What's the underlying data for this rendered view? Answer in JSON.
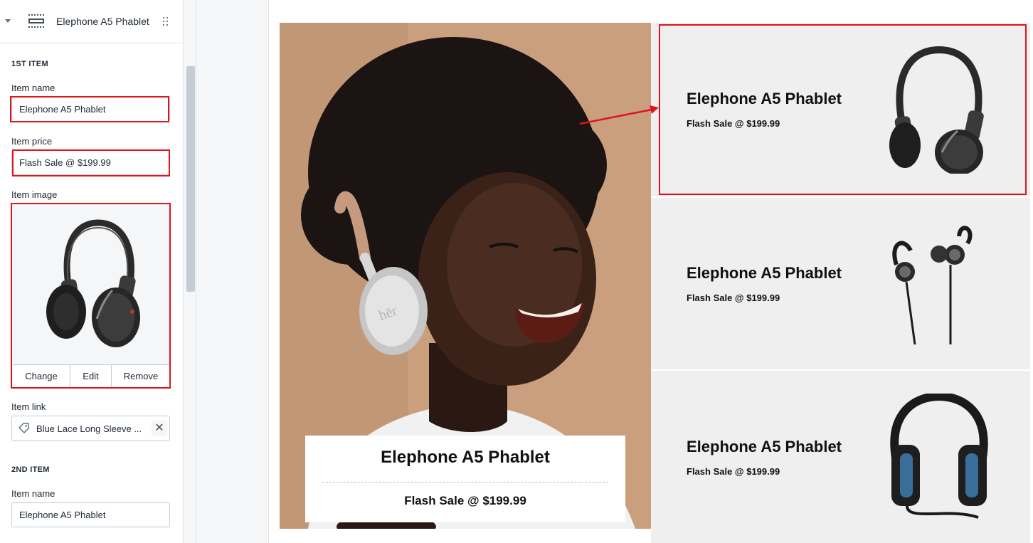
{
  "sidebar": {
    "header": {
      "title": "Elephone A5 Phablet",
      "icon": "section-icon",
      "drag_icon": "drag-handle-icon"
    },
    "first_item": {
      "heading": "1ST ITEM",
      "name_label": "Item name",
      "name_value": "Elephone A5 Phablet",
      "price_label": "Item price",
      "price_value": "Flash Sale @ $199.99",
      "image_label": "Item image",
      "image_actions": [
        "Change",
        "Edit",
        "Remove"
      ],
      "link_label": "Item link",
      "link_value": "Blue Lace Long Sleeve ..."
    },
    "second_item": {
      "heading": "2ND ITEM",
      "name_label": "Item name",
      "name_value": "Elephone A5 Phablet"
    }
  },
  "preview": {
    "hero": {
      "title": "Elephone A5 Phablet",
      "price": "Flash Sale @ $199.99"
    },
    "products": [
      {
        "title": "Elephone A5 Phablet",
        "price": "Flash Sale @ $199.99",
        "image": "over-ear-headphones"
      },
      {
        "title": "Elephone A5 Phablet",
        "price": "Flash Sale @ $199.99",
        "image": "earbuds"
      },
      {
        "title": "Elephone A5 Phablet",
        "price": "Flash Sale @ $199.99",
        "image": "studio-headphones"
      }
    ]
  },
  "colors": {
    "highlight": "#e0141d",
    "card_bg": "#efefef",
    "hero_bg": "#c49a78"
  }
}
